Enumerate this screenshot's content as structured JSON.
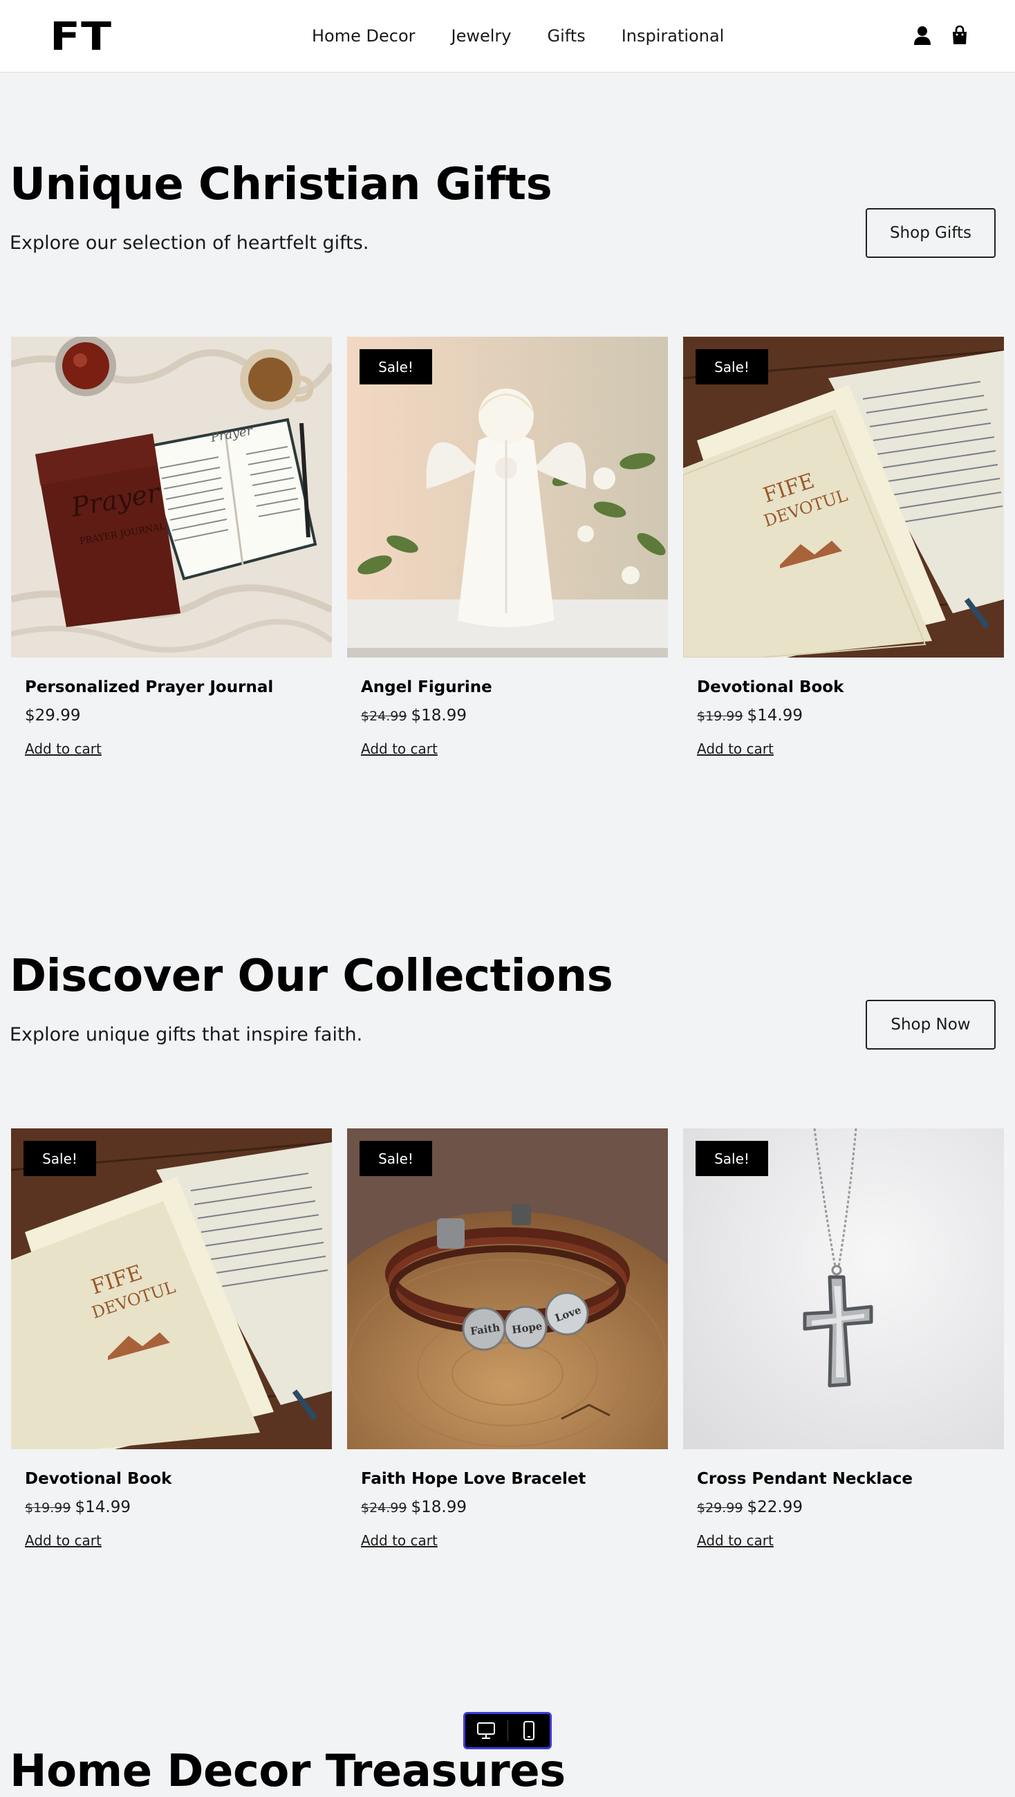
{
  "header": {
    "logo": "FT",
    "nav": [
      "Home Decor",
      "Jewelry",
      "Gifts",
      "Inspirational"
    ],
    "icons": [
      "user-icon",
      "shopping-bag-icon"
    ]
  },
  "sections": [
    {
      "title": "Unique Christian Gifts",
      "subtitle": "Explore our selection of heartfelt gifts.",
      "button": "Shop Gifts",
      "products": [
        {
          "name": "Personalized Prayer Journal",
          "price": "$29.99",
          "old_price": "",
          "sale": false,
          "add_label": "Add to cart",
          "image": "prayer-journal"
        },
        {
          "name": "Angel Figurine",
          "price": "$18.99",
          "old_price": "$24.99",
          "sale": true,
          "add_label": "Add to cart",
          "image": "angel-figurine"
        },
        {
          "name": "Devotional Book",
          "price": "$14.99",
          "old_price": "$19.99",
          "sale": true,
          "add_label": "Add to cart",
          "image": "devotional-book"
        }
      ]
    },
    {
      "title": "Discover Our Collections",
      "subtitle": "Explore unique gifts that inspire faith.",
      "button": "Shop Now",
      "products": [
        {
          "name": "Devotional Book",
          "price": "$14.99",
          "old_price": "$19.99",
          "sale": true,
          "add_label": "Add to cart",
          "image": "devotional-book"
        },
        {
          "name": "Faith Hope Love Bracelet",
          "price": "$18.99",
          "old_price": "$24.99",
          "sale": true,
          "add_label": "Add to cart",
          "image": "bracelet"
        },
        {
          "name": "Cross Pendant Necklace",
          "price": "$22.99",
          "old_price": "$29.99",
          "sale": true,
          "add_label": "Add to cart",
          "image": "cross-necklace"
        }
      ]
    },
    {
      "title": "Home Decor Treasures"
    }
  ],
  "sale_badge": "Sale!",
  "image_text": {
    "journal_title": "Prayer",
    "journal_sub": "PRAYER JOURNAL",
    "book_cover_1": "FIFE",
    "book_cover_2": "DEVOTUL",
    "charms": [
      "Faith",
      "Hope",
      "Love"
    ]
  },
  "device_toggle": [
    "desktop-icon",
    "mobile-icon"
  ]
}
